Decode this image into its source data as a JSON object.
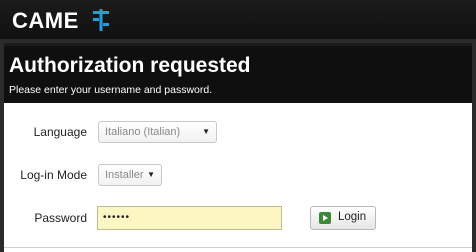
{
  "brand": {
    "name": "CAME",
    "mark_icon": "came-logo-icon",
    "mark_color": "#1ea0dc"
  },
  "auth": {
    "title": "Authorization requested",
    "subtitle": "Please enter your username and password."
  },
  "form": {
    "language": {
      "label": "Language",
      "value": "Italiano (Italian)"
    },
    "login_mode": {
      "label": "Log-in Mode",
      "value": "Installer"
    },
    "password": {
      "label": "Password",
      "value": "••••••"
    },
    "login_button": {
      "label": "Login",
      "icon": "login-arrow-icon"
    }
  },
  "colors": {
    "header_bg": "#0f0f0f",
    "password_bg": "#fbf6c2",
    "login_icon": "#3a8a35"
  }
}
